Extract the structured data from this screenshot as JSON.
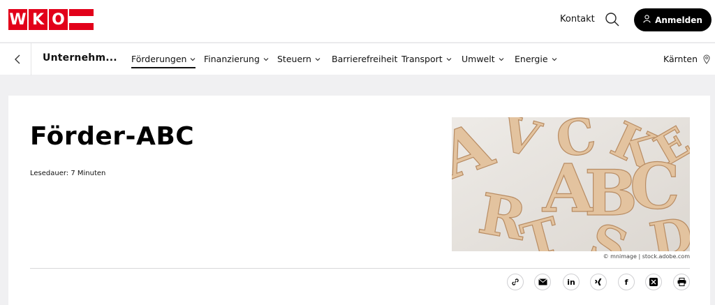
{
  "header": {
    "logo_text": "WKO",
    "logo_letters": [
      "W",
      "K",
      "O"
    ],
    "brand_color": "#e2001a",
    "contact_label": "Kontakt",
    "search_icon": "search-icon",
    "login_label": "Anmelden",
    "login_icon": "user-icon"
  },
  "nav": {
    "back_icon": "chevron-left-icon",
    "section_title": "Unternehm...",
    "items": [
      {
        "label": "Förderungen",
        "has_dropdown": true,
        "active": true
      },
      {
        "label": "Finanzierung",
        "has_dropdown": true,
        "active": false
      },
      {
        "label": "Steuern",
        "has_dropdown": true,
        "active": false
      },
      {
        "label": "Barrierefreiheit",
        "has_dropdown": false,
        "active": false
      },
      {
        "label": "Transport",
        "has_dropdown": true,
        "active": false
      },
      {
        "label": "Umwelt",
        "has_dropdown": true,
        "active": false
      },
      {
        "label": "Energie",
        "has_dropdown": true,
        "active": false
      }
    ],
    "region_label": "Kärnten",
    "region_icon": "location-pin-icon"
  },
  "article": {
    "title": "Förder-ABC",
    "reading_time": "Lesedauer: 7 Minuten",
    "image_alt": "Wooden letters ABC",
    "image_credit": "© mnimage | stock.adobe.com"
  },
  "share": [
    {
      "name": "link",
      "icon": "link-icon"
    },
    {
      "name": "email",
      "icon": "mail-icon"
    },
    {
      "name": "linkedin",
      "icon": "linkedin-icon",
      "glyph": "in"
    },
    {
      "name": "xing",
      "icon": "xing-icon"
    },
    {
      "name": "facebook",
      "icon": "facebook-icon",
      "glyph": "f"
    },
    {
      "name": "x",
      "icon": "x-icon"
    },
    {
      "name": "print",
      "icon": "print-icon"
    }
  ]
}
